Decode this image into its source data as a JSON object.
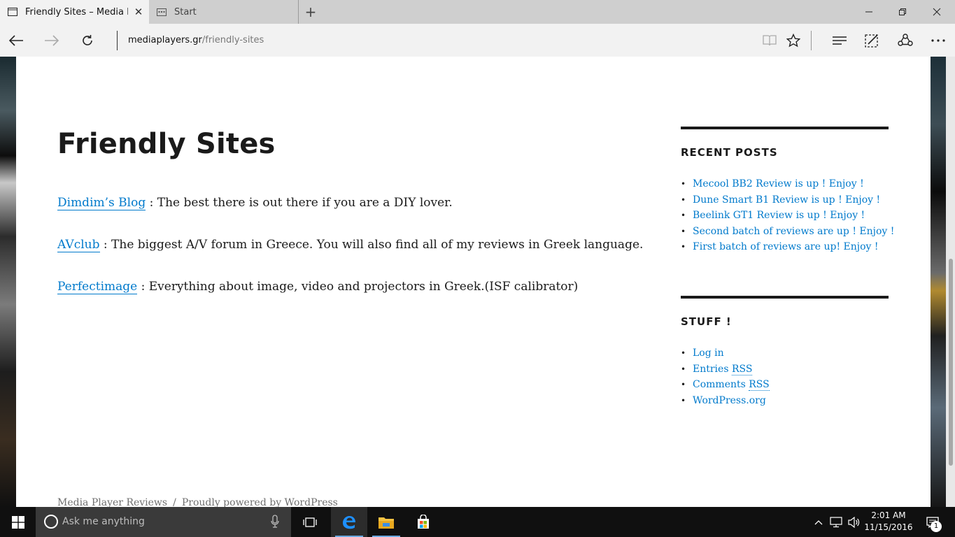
{
  "browser": {
    "tabs": [
      {
        "label": "Friendly Sites – Media P",
        "active": true
      },
      {
        "label": "Start",
        "active": false
      }
    ],
    "url_domain": "mediaplayers.gr",
    "url_path": "/friendly-sites"
  },
  "page": {
    "title": "Friendly Sites",
    "entries": [
      {
        "link": "Dimdim’s Blog",
        "text": " : The best there is out there if you are a DIY lover."
      },
      {
        "link": "AVclub",
        "text": ": The biggest A/V forum in Greece. You will also find all of my reviews in Greek language."
      },
      {
        "link": "Perfectimage",
        "text": ": Everything about image, video and projectors in Greek.(ISF calibrator)"
      }
    ]
  },
  "sidebar": {
    "recent_posts": {
      "heading": "RECENT POSTS",
      "items": [
        "Mecool BB2 Review is up ! Enjoy !",
        "Dune Smart B1 Review is up ! Enjoy !",
        "Beelink GT1 Review is up ! Enjoy !",
        "Second batch of reviews are up ! Enjoy !",
        "First batch of reviews are up! Enjoy !"
      ]
    },
    "stuff": {
      "heading": "STUFF !",
      "items": {
        "login": "Log in",
        "entries_prefix": "Entries ",
        "entries_rss": "RSS",
        "comments_prefix": "Comments ",
        "comments_rss": "RSS",
        "wordpress": "WordPress.org"
      }
    }
  },
  "footer": {
    "site_name": "Media Player Reviews",
    "separator": "/",
    "powered": "Proudly powered by WordPress"
  },
  "taskbar": {
    "search_placeholder": "Ask me anything",
    "time": "2:01 AM",
    "date": "11/15/2016",
    "notification_count": "1"
  },
  "colors": {
    "link": "#007acc",
    "edge_blue": "#1e90ff",
    "taskbar": "#101010"
  }
}
